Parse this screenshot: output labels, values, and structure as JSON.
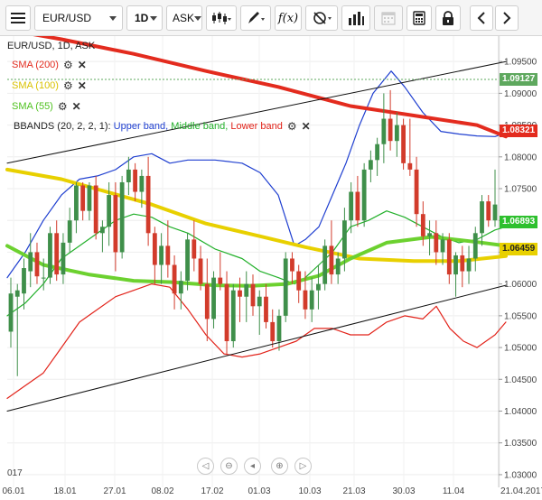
{
  "toolbar": {
    "symbol": "EUR/USD",
    "timeframe": "1D",
    "price_side": "ASK",
    "icons": [
      "menu-icon",
      "candles-icon",
      "pencil-icon",
      "function-icon",
      "crosshair-icon",
      "volume-bars-icon",
      "calendar-icon",
      "calculator-icon",
      "lock-icon",
      "chevron-left-icon",
      "chevron-right-icon"
    ]
  },
  "chart_title": "EUR/USD, 1D, ASK",
  "legend": {
    "sma200": "SMA (200)",
    "sma100": "SMA (100)",
    "sma55": "SMA (55)",
    "bbands_prefix": "BBANDS (20, 2, 2, 1):",
    "bbands_upper": "Upper band,",
    "bbands_middle": "Middle band,",
    "bbands_lower": "Lower band"
  },
  "colors": {
    "sma200": "#e32b1e",
    "sma100": "#e8d000",
    "sma55": "#6cd12f",
    "upper": "#1f3fd0",
    "middle": "#22b02a",
    "lower": "#e2231a",
    "bull": "#3f8f4a",
    "bear": "#d23b2b",
    "price_tag": "#5ea85e"
  },
  "price_tags": {
    "last": "1.09127",
    "sma200": "1.08321",
    "middle": "1.06893",
    "sma55_sma100": "1.06459"
  },
  "chart_data": {
    "type": "candlestick",
    "y_ticks": [
      "1.09500",
      "1.09000",
      "1.08500",
      "1.08000",
      "1.07500",
      "1.07000",
      "1.06500",
      "1.06000",
      "1.05500",
      "1.05000",
      "1.04500",
      "1.04000",
      "1.03500",
      "1.03000"
    ],
    "ylim": [
      1.028,
      1.099
    ],
    "x_labels": [
      "06.01",
      "18.01",
      "27.01",
      "08.02",
      "17.02",
      "01.03",
      "10.03",
      "21.03",
      "30.03",
      "11.04",
      "21.04.2017"
    ],
    "corner_label": "017",
    "candles": [
      [
        1.0525,
        1.061,
        1.05,
        1.0585
      ],
      [
        1.058,
        1.06,
        1.0455,
        1.059
      ],
      [
        1.0585,
        1.064,
        1.056,
        1.0625
      ],
      [
        1.062,
        1.068,
        1.0595,
        1.065
      ],
      [
        1.065,
        1.0665,
        1.06,
        1.0612
      ],
      [
        1.061,
        1.064,
        1.059,
        1.061
      ],
      [
        1.061,
        1.069,
        1.06,
        1.068
      ],
      [
        1.068,
        1.07,
        1.0605,
        1.0615
      ],
      [
        1.0615,
        1.068,
        1.06,
        1.0665
      ],
      [
        1.0665,
        1.072,
        1.065,
        1.07
      ],
      [
        1.07,
        1.076,
        1.068,
        1.0755
      ],
      [
        1.0755,
        1.076,
        1.07,
        1.0715
      ],
      [
        1.0715,
        1.076,
        1.07,
        1.0755
      ],
      [
        1.0755,
        1.077,
        1.067,
        1.068
      ],
      [
        1.068,
        1.07,
        1.065,
        1.069
      ],
      [
        1.069,
        1.076,
        1.066,
        1.074
      ],
      [
        1.074,
        1.076,
        1.062,
        1.065
      ],
      [
        1.065,
        1.077,
        1.064,
        1.076
      ],
      [
        1.076,
        1.08,
        1.074,
        1.078
      ],
      [
        1.078,
        1.079,
        1.073,
        1.0745
      ],
      [
        1.0745,
        1.078,
        1.072,
        1.077
      ],
      [
        1.077,
        1.08,
        1.066,
        1.068
      ],
      [
        1.068,
        1.069,
        1.06,
        1.063
      ],
      [
        1.063,
        1.068,
        1.06,
        1.066
      ],
      [
        1.066,
        1.07,
        1.061,
        1.063
      ],
      [
        1.063,
        1.0645,
        1.056,
        1.0585
      ],
      [
        1.0585,
        1.062,
        1.056,
        1.0605
      ],
      [
        1.0605,
        1.068,
        1.059,
        1.067
      ],
      [
        1.067,
        1.07,
        1.062,
        1.064
      ],
      [
        1.064,
        1.066,
        1.059,
        1.06
      ],
      [
        1.06,
        1.064,
        1.051,
        1.0545
      ],
      [
        1.0545,
        1.062,
        1.053,
        1.061
      ],
      [
        1.061,
        1.065,
        1.059,
        1.06
      ],
      [
        1.06,
        1.062,
        1.049,
        1.051
      ],
      [
        1.051,
        1.06,
        1.05,
        1.059
      ],
      [
        1.059,
        1.061,
        1.054,
        1.058
      ],
      [
        1.058,
        1.062,
        1.054,
        1.06
      ],
      [
        1.06,
        1.0615,
        1.055,
        1.0565
      ],
      [
        1.0565,
        1.059,
        1.052,
        1.058
      ],
      [
        1.058,
        1.06,
        1.053,
        1.054
      ],
      [
        1.054,
        1.056,
        1.05,
        1.051
      ],
      [
        1.051,
        1.056,
        1.0495,
        1.055
      ],
      [
        1.055,
        1.065,
        1.054,
        1.064
      ],
      [
        1.064,
        1.065,
        1.06,
        1.062
      ],
      [
        1.062,
        1.063,
        1.057,
        1.059
      ],
      [
        1.059,
        1.062,
        1.0545,
        1.056
      ],
      [
        1.056,
        1.061,
        1.054,
        1.059
      ],
      [
        1.059,
        1.063,
        1.056,
        1.06
      ],
      [
        1.06,
        1.067,
        1.059,
        1.066
      ],
      [
        1.066,
        1.07,
        1.06,
        1.0615
      ],
      [
        1.0615,
        1.065,
        1.06,
        1.064
      ],
      [
        1.064,
        1.072,
        1.062,
        1.07
      ],
      [
        1.07,
        1.076,
        1.068,
        1.0745
      ],
      [
        1.0745,
        1.077,
        1.069,
        1.07
      ],
      [
        1.07,
        1.079,
        1.069,
        1.078
      ],
      [
        1.078,
        1.081,
        1.076,
        1.0795
      ],
      [
        1.0795,
        1.083,
        1.077,
        1.082
      ],
      [
        1.082,
        1.09,
        1.079,
        1.086
      ],
      [
        1.086,
        1.0905,
        1.081,
        1.0825
      ],
      [
        1.0825,
        1.087,
        1.08,
        1.085
      ],
      [
        1.085,
        1.086,
        1.078,
        1.079
      ],
      [
        1.079,
        1.086,
        1.077,
        1.078
      ],
      [
        1.078,
        1.08,
        1.069,
        1.071
      ],
      [
        1.071,
        1.073,
        1.066,
        1.0675
      ],
      [
        1.0675,
        1.07,
        1.0645,
        1.068
      ],
      [
        1.068,
        1.07,
        1.063,
        1.065
      ],
      [
        1.065,
        1.068,
        1.063,
        1.067
      ],
      [
        1.067,
        1.068,
        1.06,
        1.0615
      ],
      [
        1.0615,
        1.065,
        1.058,
        1.0645
      ],
      [
        1.0645,
        1.066,
        1.0595,
        1.062
      ],
      [
        1.062,
        1.066,
        1.06,
        1.064
      ],
      [
        1.064,
        1.069,
        1.062,
        1.068
      ],
      [
        1.068,
        1.074,
        1.066,
        1.073
      ],
      [
        1.073,
        1.074,
        1.069,
        1.07
      ],
      [
        1.07,
        1.078,
        1.069,
        1.0725
      ]
    ],
    "series": [
      {
        "name": "SMA (200)",
        "values": [
          [
            0,
            1.1
          ],
          [
            60,
            1.0985
          ],
          [
            140,
            1.0962
          ],
          [
            220,
            1.0935
          ],
          [
            300,
            1.091
          ],
          [
            380,
            1.088
          ],
          [
            450,
            1.0865
          ],
          [
            520,
            1.085
          ],
          [
            552,
            1.0832
          ]
        ]
      },
      {
        "name": "SMA (100)",
        "values": [
          [
            0,
            1.078
          ],
          [
            60,
            1.0765
          ],
          [
            110,
            1.0745
          ],
          [
            160,
            1.0725
          ],
          [
            220,
            1.0695
          ],
          [
            280,
            1.0675
          ],
          [
            330,
            1.0658
          ],
          [
            390,
            1.064
          ],
          [
            450,
            1.0636
          ],
          [
            500,
            1.0636
          ],
          [
            552,
            1.0644
          ]
        ]
      },
      {
        "name": "SMA (55)",
        "values": [
          [
            0,
            1.066
          ],
          [
            40,
            1.063
          ],
          [
            90,
            1.0615
          ],
          [
            140,
            1.0605
          ],
          [
            180,
            1.0603
          ],
          [
            230,
            1.0598
          ],
          [
            270,
            1.0597
          ],
          [
            310,
            1.06
          ],
          [
            345,
            1.0613
          ],
          [
            380,
            1.064
          ],
          [
            420,
            1.0665
          ],
          [
            470,
            1.0674
          ],
          [
            520,
            1.0666
          ],
          [
            552,
            1.066
          ]
        ]
      },
      {
        "name": "Upper band",
        "values": [
          [
            0,
            1.061
          ],
          [
            20,
            1.065
          ],
          [
            40,
            1.07
          ],
          [
            60,
            1.074
          ],
          [
            80,
            1.0765
          ],
          [
            100,
            1.077
          ],
          [
            120,
            1.078
          ],
          [
            140,
            1.08
          ],
          [
            160,
            1.0805
          ],
          [
            180,
            1.079
          ],
          [
            200,
            1.0795
          ],
          [
            230,
            1.0795
          ],
          [
            260,
            1.079
          ],
          [
            280,
            1.0775
          ],
          [
            300,
            1.074
          ],
          [
            318,
            1.066
          ],
          [
            330,
            1.067
          ],
          [
            345,
            1.069
          ],
          [
            360,
            1.074
          ],
          [
            375,
            1.079
          ],
          [
            390,
            1.085
          ],
          [
            405,
            1.09
          ],
          [
            425,
            1.0935
          ],
          [
            440,
            1.091
          ],
          [
            460,
            1.087
          ],
          [
            480,
            1.084
          ],
          [
            500,
            1.0836
          ],
          [
            520,
            1.0833
          ],
          [
            540,
            1.0832
          ],
          [
            552,
            1.0838
          ]
        ]
      },
      {
        "name": "Middle band",
        "values": [
          [
            0,
            1.055
          ],
          [
            20,
            1.057
          ],
          [
            40,
            1.06
          ],
          [
            60,
            1.064
          ],
          [
            80,
            1.066
          ],
          [
            100,
            1.068
          ],
          [
            120,
            1.07
          ],
          [
            140,
            1.071
          ],
          [
            160,
            1.0705
          ],
          [
            180,
            1.069
          ],
          [
            200,
            1.068
          ],
          [
            230,
            1.0655
          ],
          [
            260,
            1.064
          ],
          [
            280,
            1.062
          ],
          [
            300,
            1.061
          ],
          [
            318,
            1.06
          ],
          [
            330,
            1.061
          ],
          [
            345,
            1.063
          ],
          [
            360,
            1.065
          ],
          [
            380,
            1.069
          ],
          [
            400,
            1.07
          ],
          [
            420,
            1.0715
          ],
          [
            440,
            1.0705
          ],
          [
            460,
            1.069
          ],
          [
            480,
            1.0675
          ],
          [
            500,
            1.0665
          ],
          [
            520,
            1.067
          ],
          [
            540,
            1.0685
          ],
          [
            552,
            1.069
          ]
        ]
      },
      {
        "name": "Lower band",
        "values": [
          [
            0,
            1.042
          ],
          [
            20,
            1.044
          ],
          [
            40,
            1.046
          ],
          [
            60,
            1.05
          ],
          [
            80,
            1.054
          ],
          [
            100,
            1.056
          ],
          [
            120,
            1.058
          ],
          [
            140,
            1.059
          ],
          [
            160,
            1.06
          ],
          [
            180,
            1.0595
          ],
          [
            200,
            1.056
          ],
          [
            220,
            1.052
          ],
          [
            240,
            1.049
          ],
          [
            260,
            1.0485
          ],
          [
            280,
            1.049
          ],
          [
            300,
            1.05
          ],
          [
            320,
            1.051
          ],
          [
            340,
            1.053
          ],
          [
            360,
            1.053
          ],
          [
            380,
            1.052
          ],
          [
            400,
            1.052
          ],
          [
            420,
            1.054
          ],
          [
            440,
            1.055
          ],
          [
            460,
            1.0545
          ],
          [
            475,
            1.0565
          ],
          [
            490,
            1.053
          ],
          [
            505,
            1.051
          ],
          [
            520,
            1.05
          ],
          [
            540,
            1.052
          ],
          [
            552,
            1.054
          ]
        ]
      },
      {
        "name": "Trendline upper",
        "values": [
          [
            0,
            1.079
          ],
          [
            552,
            1.095
          ]
        ]
      },
      {
        "name": "Trendline lower",
        "values": [
          [
            0,
            1.04
          ],
          [
            552,
            1.0598
          ]
        ]
      }
    ]
  }
}
